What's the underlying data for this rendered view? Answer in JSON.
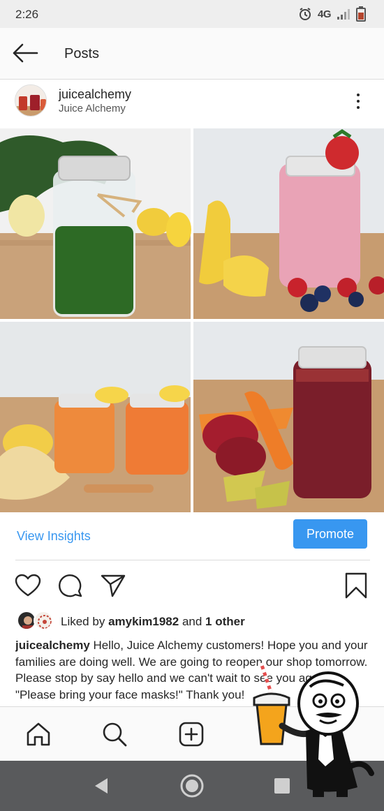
{
  "status_bar": {
    "time": "2:26",
    "network": "4G"
  },
  "header": {
    "title": "Posts"
  },
  "post": {
    "username": "juicealchemy",
    "display_name": "Juice Alchemy",
    "images": [
      {
        "name": "green-juice-jar",
        "color": "#2f6b2a"
      },
      {
        "name": "berry-smoothie-jar",
        "color": "#e09aa9"
      },
      {
        "name": "ginger-citrus-shots",
        "color": "#e8722f"
      },
      {
        "name": "beet-carrot-juice-jar",
        "color": "#7a1e2a"
      }
    ],
    "view_insights_label": "View Insights",
    "promote_label": "Promote",
    "likes": {
      "prefix": "Liked by",
      "user": "amykim1982",
      "conjunction": "and",
      "others": "1 other"
    },
    "caption": {
      "user": "juicealchemy",
      "text": "Hello, Juice Alchemy customers! Hope you and your families are doing well. We are going to reopen our shop tomorrow. Please stop by say hello and we can't wait to see you again. \"Please bring your face masks!\" Thank you!"
    }
  },
  "colors": {
    "accent": "#3897f0",
    "system_nav": "#595a5c",
    "status_bar": "#eeeeee"
  },
  "icons": {
    "back": "arrow-left-icon",
    "more": "more-vertical-icon",
    "like": "heart-icon",
    "comment": "comment-icon",
    "share": "paper-plane-icon",
    "save": "bookmark-icon",
    "home": "home-icon",
    "search": "search-icon",
    "add": "add-post-icon"
  }
}
